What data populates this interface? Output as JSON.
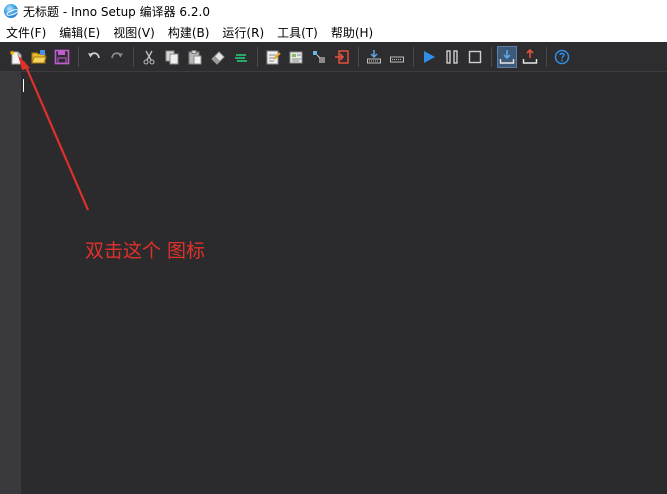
{
  "window": {
    "title": "无标题 - Inno Setup 编译器 6.2.0"
  },
  "menu": {
    "items": [
      {
        "label": "文件(F)"
      },
      {
        "label": "编辑(E)"
      },
      {
        "label": "视图(V)"
      },
      {
        "label": "构建(B)"
      },
      {
        "label": "运行(R)"
      },
      {
        "label": "工具(T)"
      },
      {
        "label": "帮助(H)"
      }
    ]
  },
  "toolbar": {
    "icons": [
      "new-file-icon",
      "open-icon",
      "save-icon",
      "undo-icon",
      "redo-icon",
      "cut-icon",
      "copy-icon",
      "paste-icon",
      "clear-icon",
      "comment-icon",
      "script-wizard-icon",
      "compile-wizard-icon",
      "debug-icon",
      "exit-icon",
      "compile-icon",
      "stop-compile-icon",
      "run-icon",
      "pause-icon",
      "stop-icon",
      "target-download-icon",
      "target-upload-icon",
      "help-icon"
    ]
  },
  "annotation": {
    "text": "双击这个 图标",
    "color": "#e0302a"
  },
  "colors": {
    "editor_bg": "#2b2b2e",
    "toolbar_bg": "#2d2d30",
    "accent_blue": "#2f8fe8"
  }
}
